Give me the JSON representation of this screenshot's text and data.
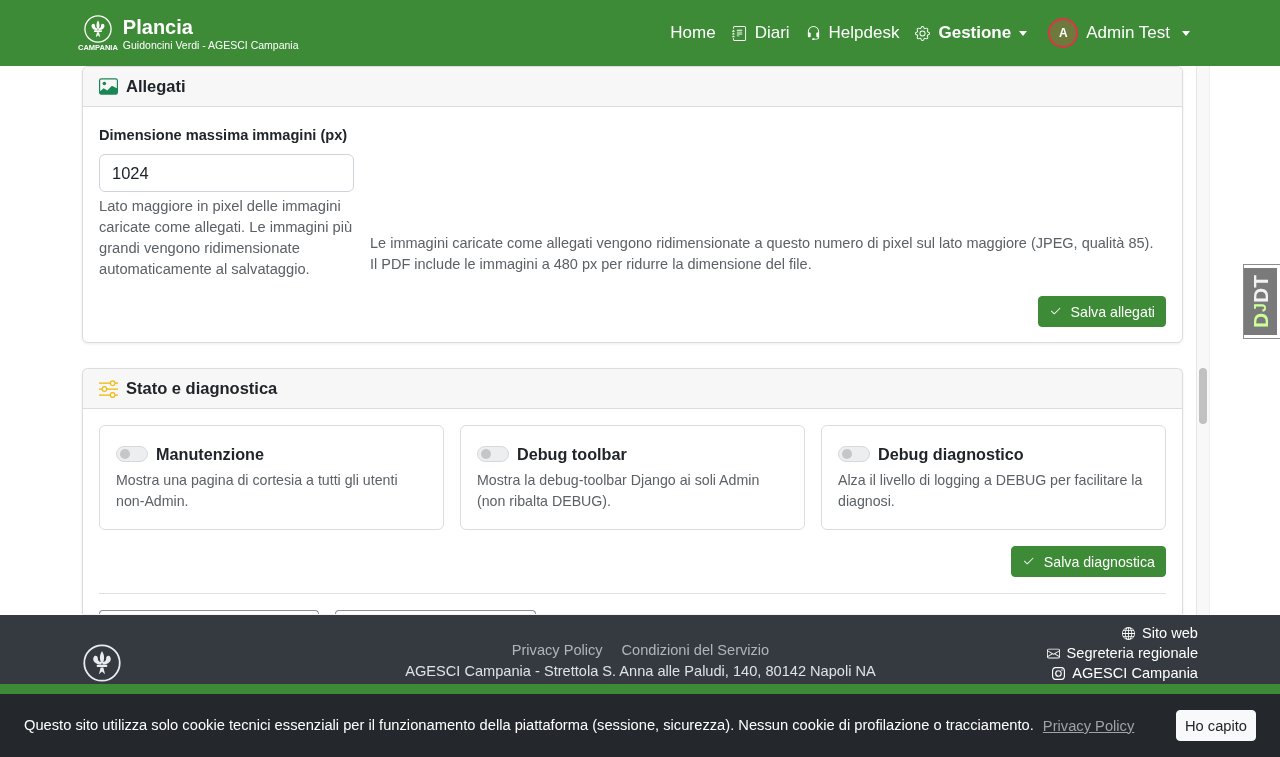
{
  "navbar": {
    "brand": {
      "logo_caption": "CAMPANIA",
      "title": "Plancia",
      "subtitle": "Guidoncini Verdi - AGESCI Campania"
    },
    "items": [
      {
        "label": "Home",
        "kind": "link",
        "selected": false
      },
      {
        "label": "Diari",
        "kind": "link",
        "selected": false
      },
      {
        "label": "Helpdesk",
        "kind": "link",
        "selected": false
      },
      {
        "label": "Gestione",
        "kind": "dropdown",
        "selected": true
      }
    ],
    "user": {
      "initial": "A",
      "name": "Admin Test"
    }
  },
  "attachments": {
    "title": "Allegati",
    "field": {
      "label": "Dimensione massima immagini (px)",
      "value": "1024",
      "help": "Lato maggiore in pixel delle immagini caricate come allegati. Le immagini più grandi vengono ridimensionate automaticamente al salvataggio."
    },
    "note": "Le immagini caricate come allegati vengono ridimensionate a questo numero di pixel sul lato maggiore (JPEG, qualità 85).\nIl PDF include le immagini a 480 px per ridurre la dimensione del file.",
    "button": "Salva allegati"
  },
  "diagnostics": {
    "title": "Stato e diagnostica",
    "options": [
      {
        "title": "Manutenzione",
        "description": "Mostra una pagina di cortesia a tutti gli utenti non-Admin.",
        "on": false
      },
      {
        "title": "Debug toolbar",
        "description": "Mostra la debug-toolbar Django ai soli Admin (non ribalta DEBUG).",
        "on": false
      },
      {
        "title": "Debug diagnostico",
        "description": "Alza il livello di logging a DEBUG per facilitare la diagnosi.",
        "on": false
      }
    ],
    "button": "Salva diagnostica"
  },
  "footer": {
    "links": [
      "Privacy Policy",
      "Condizioni del Servizio"
    ],
    "address": "AGESCI Campania - Strettola S. Anna alle Paludi, 140, 80142 Napoli NA",
    "contacts": [
      "Sito web",
      "Segreteria regionale",
      "AGESCI Campania"
    ]
  },
  "cookie_banner": {
    "message": "Questo sito utilizza solo cookie tecnici essenziali per il funzionamento della piattaforma (sessione, sicurezza). Nessun cookie di profilazione o tracciamento.",
    "link": "Privacy Policy",
    "button": "Ho capito"
  },
  "debug_toolbar_handle": {
    "label_parts": [
      "D",
      "J",
      "DT"
    ]
  }
}
